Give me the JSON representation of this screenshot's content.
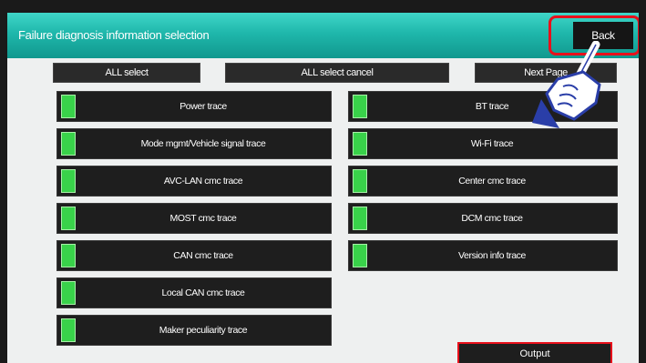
{
  "header": {
    "title": "Failure diagnosis information selection"
  },
  "toolbar": {
    "all_select_label": "ALL select",
    "all_select_cancel_label": "ALL select cancel",
    "next_page_label": "Next Page",
    "back_label": "Back"
  },
  "left_items": [
    {
      "label": "Power trace",
      "checked": true
    },
    {
      "label": "Mode mgmt/Vehicle signal trace",
      "checked": true
    },
    {
      "label": "AVC-LAN cmc trace",
      "checked": true
    },
    {
      "label": "MOST cmc trace",
      "checked": true
    },
    {
      "label": "CAN cmc trace",
      "checked": true
    },
    {
      "label": "Local CAN cmc trace",
      "checked": true
    },
    {
      "label": "Maker peculiarity trace",
      "checked": true
    }
  ],
  "right_items": [
    {
      "label": "BT trace",
      "checked": true
    },
    {
      "label": "Wi-Fi trace",
      "checked": true
    },
    {
      "label": "Center cmc trace",
      "checked": true
    },
    {
      "label": "DCM cmc trace",
      "checked": true
    },
    {
      "label": "Version info trace",
      "checked": true
    }
  ],
  "footer": {
    "output_label": "Output"
  },
  "colors": {
    "header": "#1fb7ab",
    "checked": "#39d24a",
    "highlight": "#e8101b"
  }
}
